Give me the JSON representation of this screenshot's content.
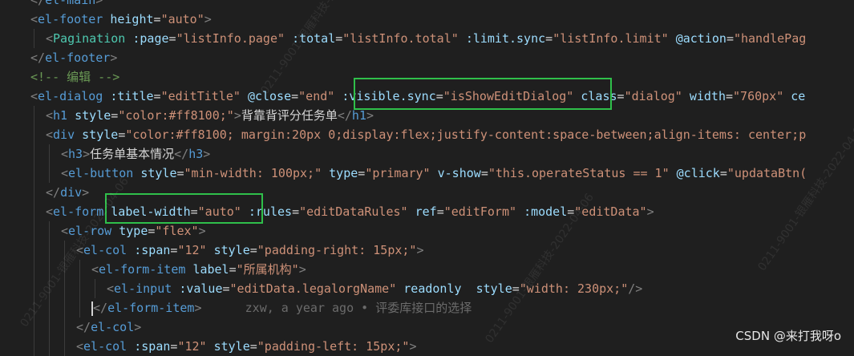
{
  "lines": [
    {
      "indent": 1,
      "tokens": [
        {
          "c": "t-punct",
          "s": "</"
        },
        {
          "c": "t-tag",
          "s": "el-main"
        },
        {
          "c": "t-punct",
          "s": ">"
        }
      ]
    },
    {
      "indent": 1,
      "tokens": [
        {
          "c": "t-punct",
          "s": "<"
        },
        {
          "c": "t-tag",
          "s": "el-footer"
        },
        {
          "c": "t-text",
          "s": " "
        },
        {
          "c": "t-attr",
          "s": "height"
        },
        {
          "c": "t-eq",
          "s": "="
        },
        {
          "c": "t-str",
          "s": "\"auto\""
        },
        {
          "c": "t-punct",
          "s": ">"
        }
      ]
    },
    {
      "indent": 2,
      "tokens": [
        {
          "c": "t-punct",
          "s": "<"
        },
        {
          "c": "t-comp",
          "s": "Pagination"
        },
        {
          "c": "t-text",
          "s": " "
        },
        {
          "c": "t-attr",
          "s": ":page"
        },
        {
          "c": "t-eq",
          "s": "="
        },
        {
          "c": "t-str",
          "s": "\"listInfo.page\""
        },
        {
          "c": "t-text",
          "s": " "
        },
        {
          "c": "t-attr",
          "s": ":total"
        },
        {
          "c": "t-eq",
          "s": "="
        },
        {
          "c": "t-str",
          "s": "\"listInfo.total\""
        },
        {
          "c": "t-text",
          "s": " "
        },
        {
          "c": "t-attr",
          "s": ":limit.sync"
        },
        {
          "c": "t-eq",
          "s": "="
        },
        {
          "c": "t-str",
          "s": "\"listInfo.limit\""
        },
        {
          "c": "t-text",
          "s": " "
        },
        {
          "c": "t-attr",
          "s": "@action"
        },
        {
          "c": "t-eq",
          "s": "="
        },
        {
          "c": "t-str",
          "s": "\"handlePag"
        }
      ]
    },
    {
      "indent": 1,
      "tokens": [
        {
          "c": "t-punct",
          "s": "</"
        },
        {
          "c": "t-tag",
          "s": "el-footer"
        },
        {
          "c": "t-punct",
          "s": ">"
        }
      ]
    },
    {
      "indent": 1,
      "tokens": [
        {
          "c": "t-comment",
          "s": "<!-- 编辑 -->"
        }
      ]
    },
    {
      "indent": 1,
      "tokens": [
        {
          "c": "t-punct",
          "s": "<"
        },
        {
          "c": "t-tag",
          "s": "el-dialog"
        },
        {
          "c": "t-text",
          "s": " "
        },
        {
          "c": "t-attr",
          "s": ":title"
        },
        {
          "c": "t-eq",
          "s": "="
        },
        {
          "c": "t-str",
          "s": "\"editTitle\""
        },
        {
          "c": "t-text",
          "s": " "
        },
        {
          "c": "t-attr",
          "s": "@close"
        },
        {
          "c": "t-eq",
          "s": "="
        },
        {
          "c": "t-str",
          "s": "\"end\""
        },
        {
          "c": "t-text",
          "s": " "
        },
        {
          "c": "t-attr",
          "s": ":visible.sync"
        },
        {
          "c": "t-eq",
          "s": "="
        },
        {
          "c": "t-str",
          "s": "\"isShowEditDialog\""
        },
        {
          "c": "t-text",
          "s": " "
        },
        {
          "c": "t-attr",
          "s": "class"
        },
        {
          "c": "t-eq",
          "s": "="
        },
        {
          "c": "t-str",
          "s": "\"dialog\""
        },
        {
          "c": "t-text",
          "s": " "
        },
        {
          "c": "t-attr",
          "s": "width"
        },
        {
          "c": "t-eq",
          "s": "="
        },
        {
          "c": "t-str",
          "s": "\"760px\""
        },
        {
          "c": "t-text",
          "s": " "
        },
        {
          "c": "t-attr",
          "s": "ce"
        }
      ]
    },
    {
      "indent": 2,
      "tokens": [
        {
          "c": "t-punct",
          "s": "<"
        },
        {
          "c": "t-tag",
          "s": "h1"
        },
        {
          "c": "t-text",
          "s": " "
        },
        {
          "c": "t-attr",
          "s": "style"
        },
        {
          "c": "t-eq",
          "s": "="
        },
        {
          "c": "t-str",
          "s": "\"color:#ff8100;\""
        },
        {
          "c": "t-punct",
          "s": ">"
        },
        {
          "c": "t-text",
          "s": "背靠背评分任务单"
        },
        {
          "c": "t-punct",
          "s": "</"
        },
        {
          "c": "t-tag",
          "s": "h1"
        },
        {
          "c": "t-punct",
          "s": ">"
        }
      ]
    },
    {
      "indent": 2,
      "tokens": [
        {
          "c": "t-punct",
          "s": "<"
        },
        {
          "c": "t-tag",
          "s": "div"
        },
        {
          "c": "t-text",
          "s": " "
        },
        {
          "c": "t-attr",
          "s": "style"
        },
        {
          "c": "t-eq",
          "s": "="
        },
        {
          "c": "t-str",
          "s": "\"color:#ff8100; margin:20px 0;display:flex;justify-content:space-between;align-items: center;p"
        }
      ]
    },
    {
      "indent": 3,
      "tokens": [
        {
          "c": "t-punct",
          "s": "<"
        },
        {
          "c": "t-tag",
          "s": "h3"
        },
        {
          "c": "t-punct",
          "s": ">"
        },
        {
          "c": "t-text",
          "s": "任务单基本情况"
        },
        {
          "c": "t-punct",
          "s": "</"
        },
        {
          "c": "t-tag",
          "s": "h3"
        },
        {
          "c": "t-punct",
          "s": ">"
        }
      ]
    },
    {
      "indent": 3,
      "tokens": [
        {
          "c": "t-punct",
          "s": "<"
        },
        {
          "c": "t-tag",
          "s": "el-button"
        },
        {
          "c": "t-text",
          "s": " "
        },
        {
          "c": "t-attr",
          "s": "style"
        },
        {
          "c": "t-eq",
          "s": "="
        },
        {
          "c": "t-str",
          "s": "\"min-width: 100px;\""
        },
        {
          "c": "t-text",
          "s": " "
        },
        {
          "c": "t-attr",
          "s": "type"
        },
        {
          "c": "t-eq",
          "s": "="
        },
        {
          "c": "t-str",
          "s": "\"primary\""
        },
        {
          "c": "t-text",
          "s": " "
        },
        {
          "c": "t-attr",
          "s": "v-show"
        },
        {
          "c": "t-eq",
          "s": "="
        },
        {
          "c": "t-str",
          "s": "\"this.operateStatus == 1\""
        },
        {
          "c": "t-text",
          "s": " "
        },
        {
          "c": "t-attr",
          "s": "@click"
        },
        {
          "c": "t-eq",
          "s": "="
        },
        {
          "c": "t-str",
          "s": "\"updataBtn("
        }
      ]
    },
    {
      "indent": 2,
      "tokens": [
        {
          "c": "t-punct",
          "s": "</"
        },
        {
          "c": "t-tag",
          "s": "div"
        },
        {
          "c": "t-punct",
          "s": ">"
        }
      ]
    },
    {
      "indent": 2,
      "tokens": [
        {
          "c": "t-punct",
          "s": "<"
        },
        {
          "c": "t-tag",
          "s": "el-form"
        },
        {
          "c": "t-text",
          "s": " "
        },
        {
          "c": "t-attr",
          "s": "label-width"
        },
        {
          "c": "t-eq",
          "s": "="
        },
        {
          "c": "t-str",
          "s": "\"auto\""
        },
        {
          "c": "t-text",
          "s": " "
        },
        {
          "c": "t-attr",
          "s": ":rules"
        },
        {
          "c": "t-eq",
          "s": "="
        },
        {
          "c": "t-str",
          "s": "\"editDataRules\""
        },
        {
          "c": "t-text",
          "s": " "
        },
        {
          "c": "t-attr",
          "s": "ref"
        },
        {
          "c": "t-eq",
          "s": "="
        },
        {
          "c": "t-str",
          "s": "\"editForm\""
        },
        {
          "c": "t-text",
          "s": " "
        },
        {
          "c": "t-attr",
          "s": ":model"
        },
        {
          "c": "t-eq",
          "s": "="
        },
        {
          "c": "t-str",
          "s": "\"editData\""
        },
        {
          "c": "t-punct",
          "s": ">"
        }
      ]
    },
    {
      "indent": 3,
      "tokens": [
        {
          "c": "t-punct",
          "s": "<"
        },
        {
          "c": "t-tag",
          "s": "el-row"
        },
        {
          "c": "t-text",
          "s": " "
        },
        {
          "c": "t-attr",
          "s": "type"
        },
        {
          "c": "t-eq",
          "s": "="
        },
        {
          "c": "t-str",
          "s": "\"flex\""
        },
        {
          "c": "t-punct",
          "s": ">"
        }
      ]
    },
    {
      "indent": 4,
      "tokens": [
        {
          "c": "t-punct",
          "s": "<"
        },
        {
          "c": "t-tag",
          "s": "el-col"
        },
        {
          "c": "t-text",
          "s": " "
        },
        {
          "c": "t-attr",
          "s": ":span"
        },
        {
          "c": "t-eq",
          "s": "="
        },
        {
          "c": "t-str",
          "s": "\"12\""
        },
        {
          "c": "t-text",
          "s": " "
        },
        {
          "c": "t-attr",
          "s": "style"
        },
        {
          "c": "t-eq",
          "s": "="
        },
        {
          "c": "t-str",
          "s": "\"padding-right: 15px;\""
        },
        {
          "c": "t-punct",
          "s": ">"
        }
      ]
    },
    {
      "indent": 5,
      "tokens": [
        {
          "c": "t-punct",
          "s": "<"
        },
        {
          "c": "t-tag",
          "s": "el-form-item"
        },
        {
          "c": "t-text",
          "s": " "
        },
        {
          "c": "t-attr",
          "s": "label"
        },
        {
          "c": "t-eq",
          "s": "="
        },
        {
          "c": "t-str",
          "s": "\"所属机构\""
        },
        {
          "c": "t-punct",
          "s": ">"
        }
      ]
    },
    {
      "indent": 6,
      "tokens": [
        {
          "c": "t-punct",
          "s": "<"
        },
        {
          "c": "t-tag",
          "s": "el-input"
        },
        {
          "c": "t-text",
          "s": " "
        },
        {
          "c": "t-attr",
          "s": ":value"
        },
        {
          "c": "t-eq",
          "s": "="
        },
        {
          "c": "t-str",
          "s": "\"editData.legalorgName\""
        },
        {
          "c": "t-text",
          "s": " "
        },
        {
          "c": "t-attr",
          "s": "readonly"
        },
        {
          "c": "t-text",
          "s": "  "
        },
        {
          "c": "t-attr",
          "s": "style"
        },
        {
          "c": "t-eq",
          "s": "="
        },
        {
          "c": "t-str",
          "s": "\"width: 230px;\""
        },
        {
          "c": "t-punct",
          "s": "/>"
        }
      ]
    },
    {
      "indent": 5,
      "cursor": true,
      "tokens": [
        {
          "c": "t-punct",
          "s": "</"
        },
        {
          "c": "t-tag",
          "s": "el-form-item"
        },
        {
          "c": "t-punct",
          "s": ">"
        },
        {
          "c": "t-text",
          "s": "      "
        },
        {
          "c": "t-blame",
          "s": "zxw, a year ago • 评委库接口的选择"
        }
      ]
    },
    {
      "indent": 4,
      "tokens": [
        {
          "c": "t-punct",
          "s": "</"
        },
        {
          "c": "t-tag",
          "s": "el-col"
        },
        {
          "c": "t-punct",
          "s": ">"
        }
      ]
    },
    {
      "indent": 4,
      "tokens": [
        {
          "c": "t-punct",
          "s": "<"
        },
        {
          "c": "t-tag",
          "s": "el-col"
        },
        {
          "c": "t-text",
          "s": " "
        },
        {
          "c": "t-attr",
          "s": ":span"
        },
        {
          "c": "t-eq",
          "s": "="
        },
        {
          "c": "t-str",
          "s": "\"12\""
        },
        {
          "c": "t-text",
          "s": " "
        },
        {
          "c": "t-attr",
          "s": "style"
        },
        {
          "c": "t-eq",
          "s": "="
        },
        {
          "c": "t-str",
          "s": "\"padding-left: 15px;\""
        },
        {
          "c": "t-punct",
          "s": ">"
        }
      ]
    }
  ],
  "watermark_text": "0211-9001-银雁科技-2022-04-06",
  "csdn_credit": "CSDN @来打我呀o"
}
